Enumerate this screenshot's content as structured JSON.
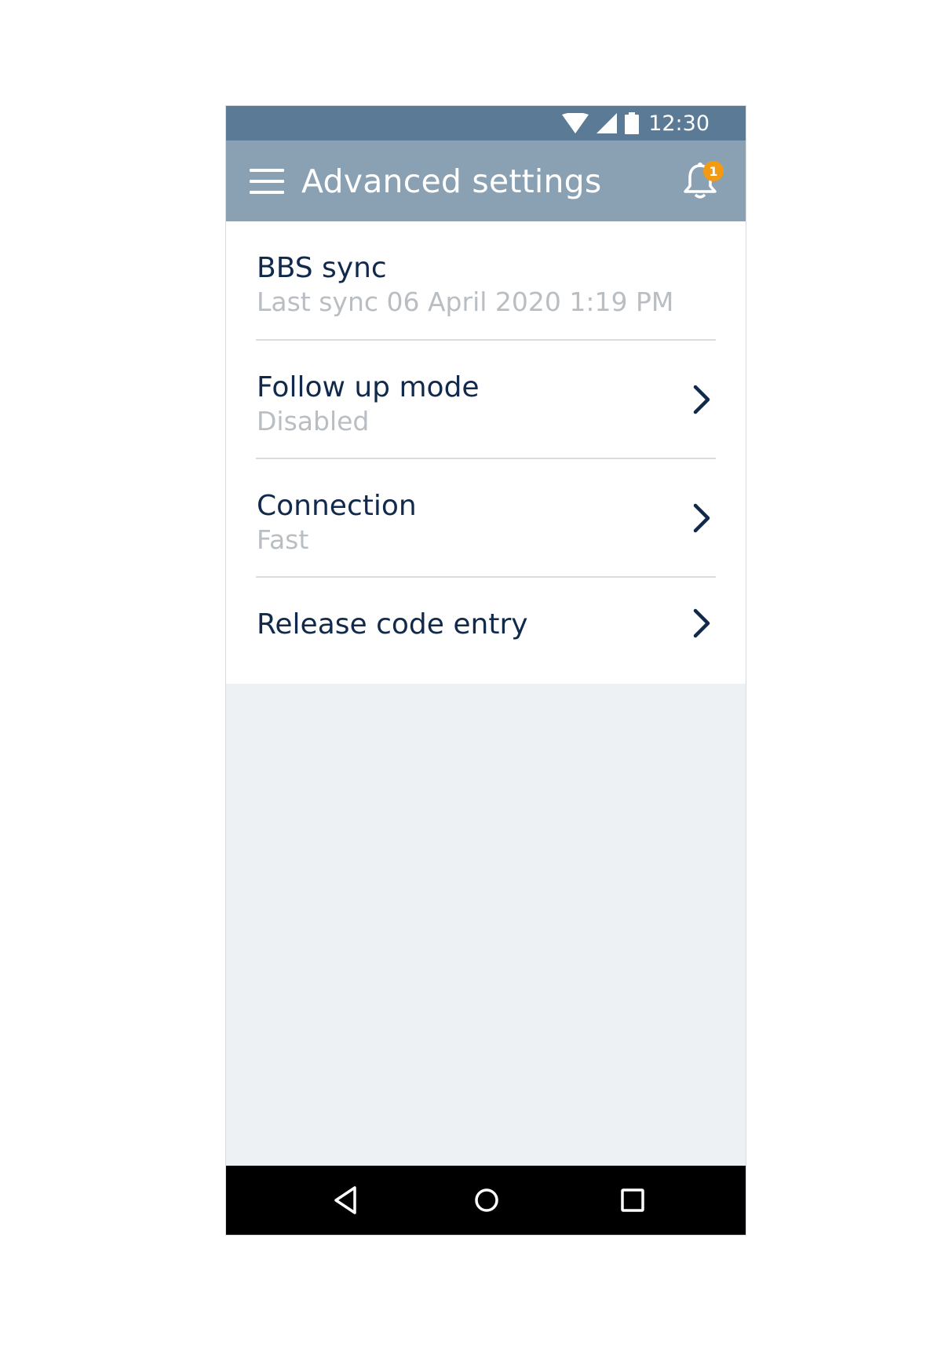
{
  "status_bar": {
    "time": "12:30",
    "icons": [
      "wifi-icon",
      "signal-icon",
      "battery-icon"
    ]
  },
  "app_bar": {
    "title": "Advanced settings",
    "menu_icon": "hamburger-menu-icon",
    "notification_icon": "bell-icon",
    "notification_count": "1"
  },
  "settings": {
    "items": [
      {
        "title": "BBS sync",
        "subtitle": "Last sync 06 April 2020 1:19 PM",
        "has_chevron": false
      },
      {
        "title": "Follow up mode",
        "subtitle": "Disabled",
        "has_chevron": true
      },
      {
        "title": "Connection",
        "subtitle": "Fast",
        "has_chevron": true
      },
      {
        "title": "Release code entry",
        "subtitle": "",
        "has_chevron": true
      }
    ]
  },
  "nav_bar": {
    "buttons": [
      "back-icon",
      "home-icon",
      "recents-icon"
    ]
  },
  "colors": {
    "status_bar": "#5b7a96",
    "app_bar": "#8aa0b3",
    "title_text": "#112a4c",
    "subtitle_text": "#b9bec3",
    "badge": "#f29a12",
    "background": "#eef1f3"
  }
}
